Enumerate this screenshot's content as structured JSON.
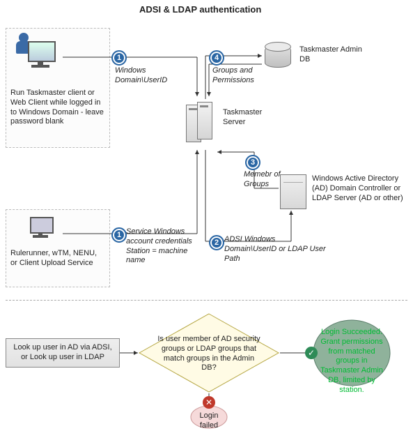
{
  "title": "ADSI & LDAP authentication",
  "client": {
    "label": "Run Taskmaster client or Web Client while logged in to Windows Domain - leave password blank"
  },
  "services": {
    "label": "Rulerunner, wTM, NENU, or Client Upload Service"
  },
  "taskmaster_server": {
    "label": "Taskmaster Server"
  },
  "admin_db": {
    "label": "Taskmaster Admin DB"
  },
  "ad_server": {
    "label": "Windows Active Directory (AD) Domain Controller or LDAP Server (AD or other)"
  },
  "step1": {
    "num": "1",
    "text": "Windows Domain\\UserID"
  },
  "step1b": {
    "num": "1",
    "text": "Service Windows account credentials Station = machine name"
  },
  "step2": {
    "num": "2",
    "text": "ADSI Windows Domain\\UserID or LDAP User Path"
  },
  "step3": {
    "num": "3",
    "text": "Memebr of Groups"
  },
  "step4": {
    "num": "4",
    "text": "Groups and Permissions"
  },
  "flow": {
    "lookup": "Look up user in AD via ADSI, or Look up user in LDAP",
    "decision": "Is user member of AD security groups or LDAP groups that match groups in the Admin DB?",
    "success": "Login Succeeded. Grant permissions from matched groups in Taskmaster Admin DB, limited by station.",
    "fail": "Login failed"
  }
}
